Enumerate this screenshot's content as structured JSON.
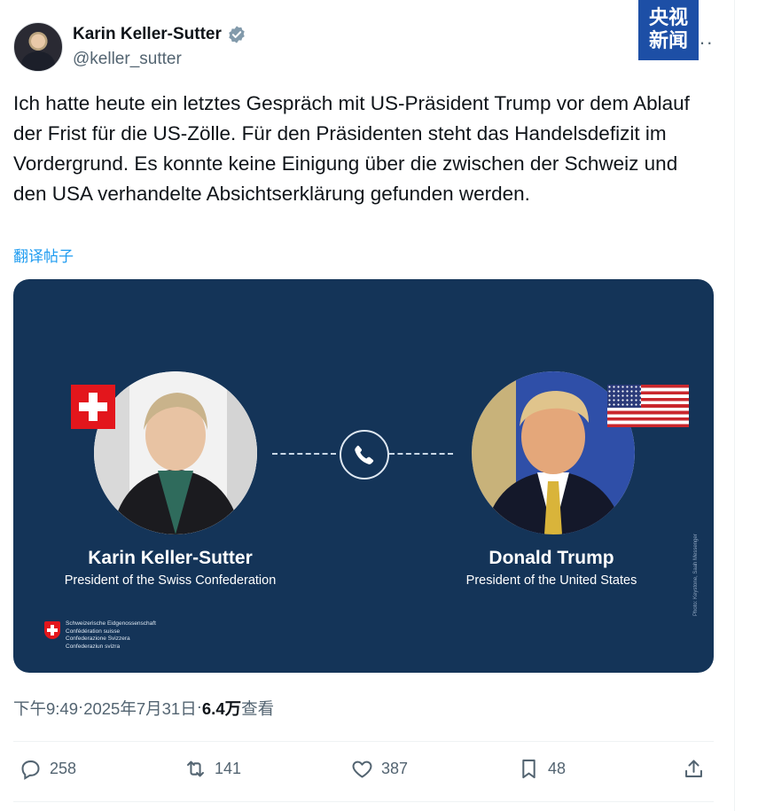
{
  "author": {
    "display_name": "Karin Keller-Sutter",
    "handle": "@keller_sutter",
    "verified_icon": "verified-badge-icon",
    "more_icon": "more-options-icon"
  },
  "watermark": {
    "line1": "央视",
    "line2": "新闻"
  },
  "tweet": {
    "text": "Ich hatte heute ein letztes Gespräch mit US-Präsident Trump vor dem Ablauf der Frist für die US-Zölle. Für den Präsidenten steht das Handelsdefizit im Vordergrund. Es konnte keine Einigung über die zwischen der Schweiz und den USA verhandelte Absichtserklärung gefunden werden.",
    "translate_label": "翻译帖子"
  },
  "media": {
    "left_person": {
      "name": "Karin Keller-Sutter",
      "title": "President of the Swiss Confederation"
    },
    "right_person": {
      "name": "Donald Trump",
      "title": "President of the United States"
    },
    "federal_lines": [
      "Schweizerische Eidgenossenschaft",
      "Confédération suisse",
      "Confederazione Svizzera",
      "Confederaziun svizra"
    ],
    "photo_credit": "Photo: Keystone, Saah Messenger",
    "colors": {
      "background": "#143458",
      "swiss_red": "#e3161c"
    }
  },
  "meta": {
    "time": "下午9:49",
    "sep1": " · ",
    "date": "2025年7月31日",
    "sep2": " · ",
    "views_count": "6.4万",
    "views_label": " 查看"
  },
  "actions": {
    "replies": "258",
    "reposts": "141",
    "likes": "387",
    "bookmarks": "48"
  }
}
